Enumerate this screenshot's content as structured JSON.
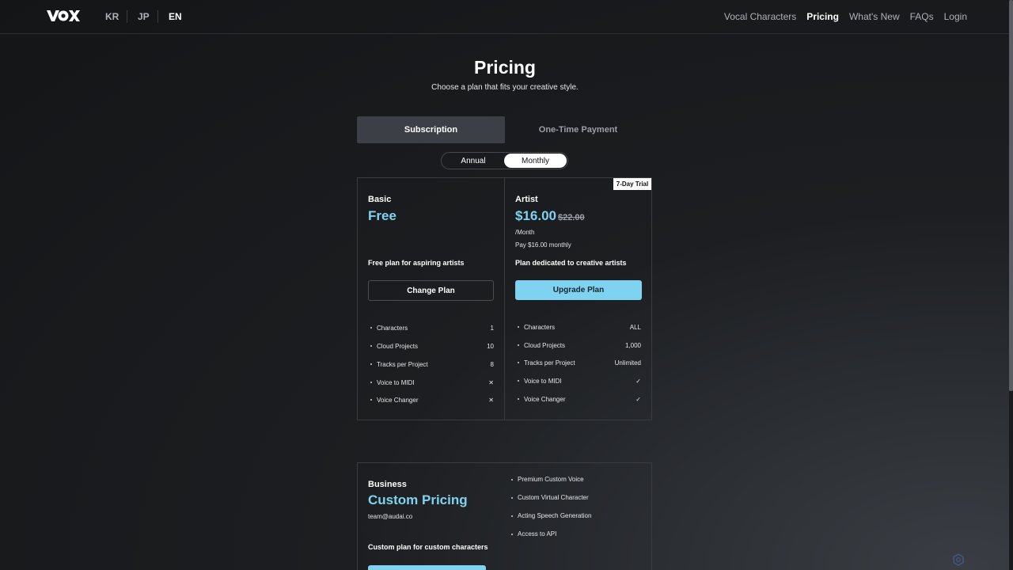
{
  "nav": {
    "brand": "VOX",
    "languages": [
      {
        "label": "KR",
        "active": false
      },
      {
        "label": "JP",
        "active": false
      },
      {
        "label": "EN",
        "active": true
      }
    ],
    "links": [
      {
        "label": "Vocal Characters",
        "active": false
      },
      {
        "label": "Pricing",
        "active": true
      },
      {
        "label": "What's New",
        "active": false
      },
      {
        "label": "FAQs",
        "active": false
      },
      {
        "label": "Login",
        "active": false
      }
    ]
  },
  "header": {
    "title": "Pricing",
    "subtitle": "Choose a plan that fits your creative style."
  },
  "tabs": {
    "subscription": "Subscription",
    "one_time": "One-Time Payment",
    "selected": "Subscription"
  },
  "billing_toggle": {
    "annual": "Annual",
    "monthly": "Monthly",
    "selected": "Monthly"
  },
  "plans": {
    "basic": {
      "name": "Basic",
      "price": "Free",
      "description": "Free plan for aspiring artists",
      "button": "Change Plan",
      "features": [
        {
          "label": "Characters",
          "value": "1"
        },
        {
          "label": "Cloud Projects",
          "value": "10"
        },
        {
          "label": "Tracks per Project",
          "value": "8"
        },
        {
          "label": "Voice to MIDI",
          "value": "✕"
        },
        {
          "label": "Voice Changer",
          "value": "✕"
        }
      ]
    },
    "artist": {
      "badge": "7-Day Trial",
      "name": "Artist",
      "price": "$16.00",
      "old_price": "$22.00",
      "period": "/Month",
      "pay_note": "Pay $16.00 monthly",
      "description": "Plan dedicated to creative artists",
      "button": "Upgrade Plan",
      "features": [
        {
          "label": "Characters",
          "value": "ALL"
        },
        {
          "label": "Cloud Projects",
          "value": "1,000"
        },
        {
          "label": "Tracks per Project",
          "value": "Unlimited"
        },
        {
          "label": "Voice to MIDI",
          "value": "✓"
        },
        {
          "label": "Voice Changer",
          "value": "✓"
        }
      ]
    },
    "business": {
      "name": "Business",
      "price": "Custom Pricing",
      "email": "team@audai.co",
      "description": "Custom plan for custom characters",
      "features": [
        "Premium Custom Voice",
        "Custom Virtual Character",
        "Acting Speech Generation",
        "Access to API"
      ]
    }
  },
  "colors": {
    "accent": "#7fd3f0",
    "background": "#1c1e21"
  }
}
